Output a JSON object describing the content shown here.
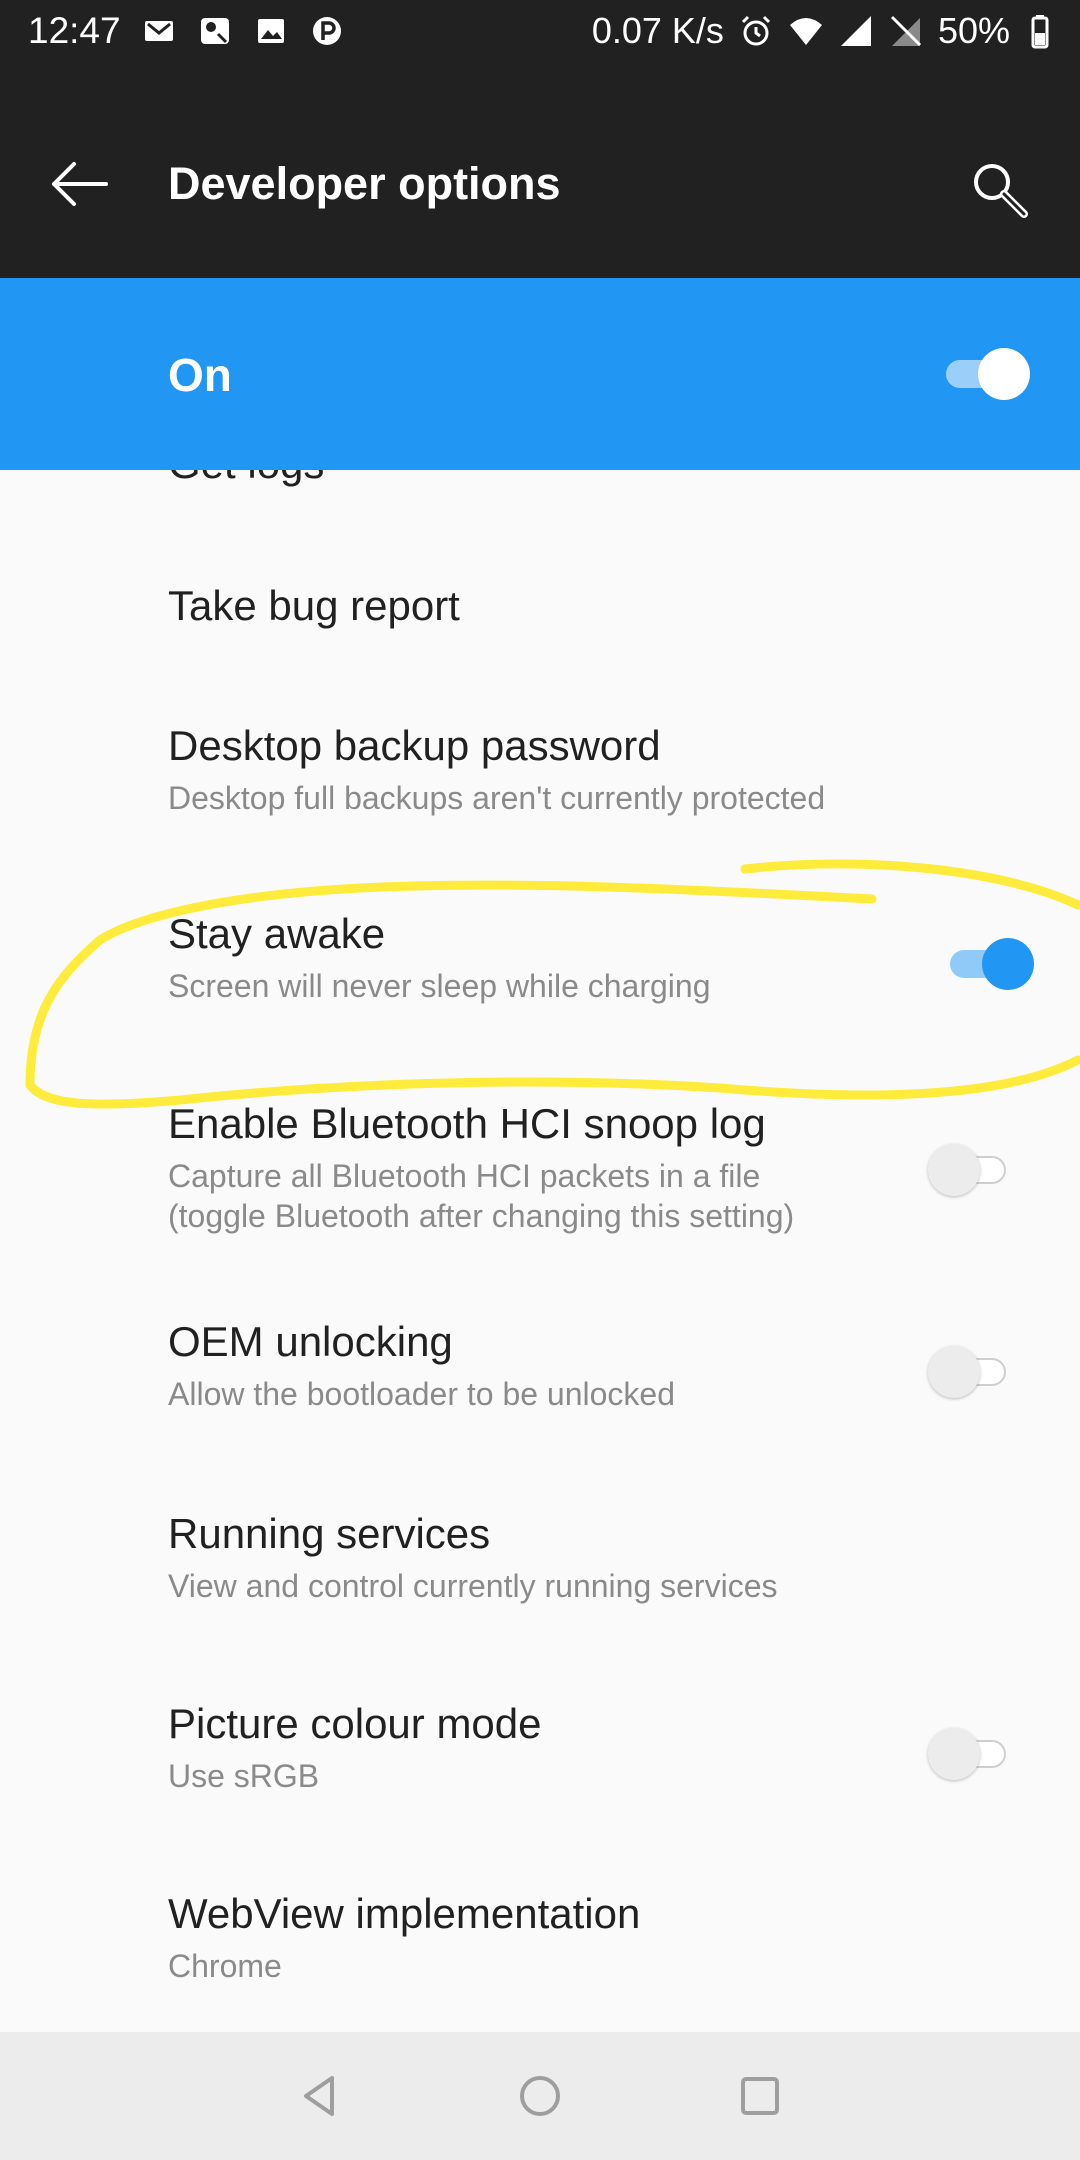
{
  "status_bar": {
    "time": "12:47",
    "net_speed": "0.07 K/s",
    "battery": "50%",
    "left_icons": [
      "gmail-icon",
      "maps-icon",
      "gallery-icon",
      "parking-icon"
    ],
    "right_icons": [
      "alarm-icon",
      "wifi-icon",
      "signal-icon",
      "no-sim-icon",
      "battery-icon"
    ]
  },
  "app_bar": {
    "title": "Developer options",
    "back_icon": "back-arrow-icon",
    "search_icon": "search-icon"
  },
  "master_switch": {
    "label": "On",
    "checked": true
  },
  "settings": [
    {
      "title": "Get logs"
    },
    {
      "title": "Take bug report"
    },
    {
      "title": "Desktop backup password",
      "summary": "Desktop full backups aren't currently protected"
    },
    {
      "title": "Stay awake",
      "summary": "Screen will never sleep while charging",
      "toggle": true
    },
    {
      "title": "Enable Bluetooth HCI snoop log",
      "summary_lines": [
        "Capture all Bluetooth HCI packets in a file",
        "(toggle Bluetooth after changing this setting)"
      ],
      "toggle": false
    },
    {
      "title": "OEM unlocking",
      "summary": "Allow the bootloader to be unlocked",
      "toggle": false
    },
    {
      "title": "Running services",
      "summary": "View and control currently running services"
    },
    {
      "title": "Picture colour mode",
      "summary": "Use sRGB",
      "toggle": false
    },
    {
      "title": "WebView implementation",
      "summary": "Chrome"
    }
  ],
  "nav_bar": {
    "icons": [
      "back-triangle-icon",
      "home-circle-icon",
      "recents-square-icon"
    ]
  },
  "colors": {
    "accent": "#2196f3",
    "toolbar": "#212121",
    "highlight": "#ffeb3b"
  }
}
